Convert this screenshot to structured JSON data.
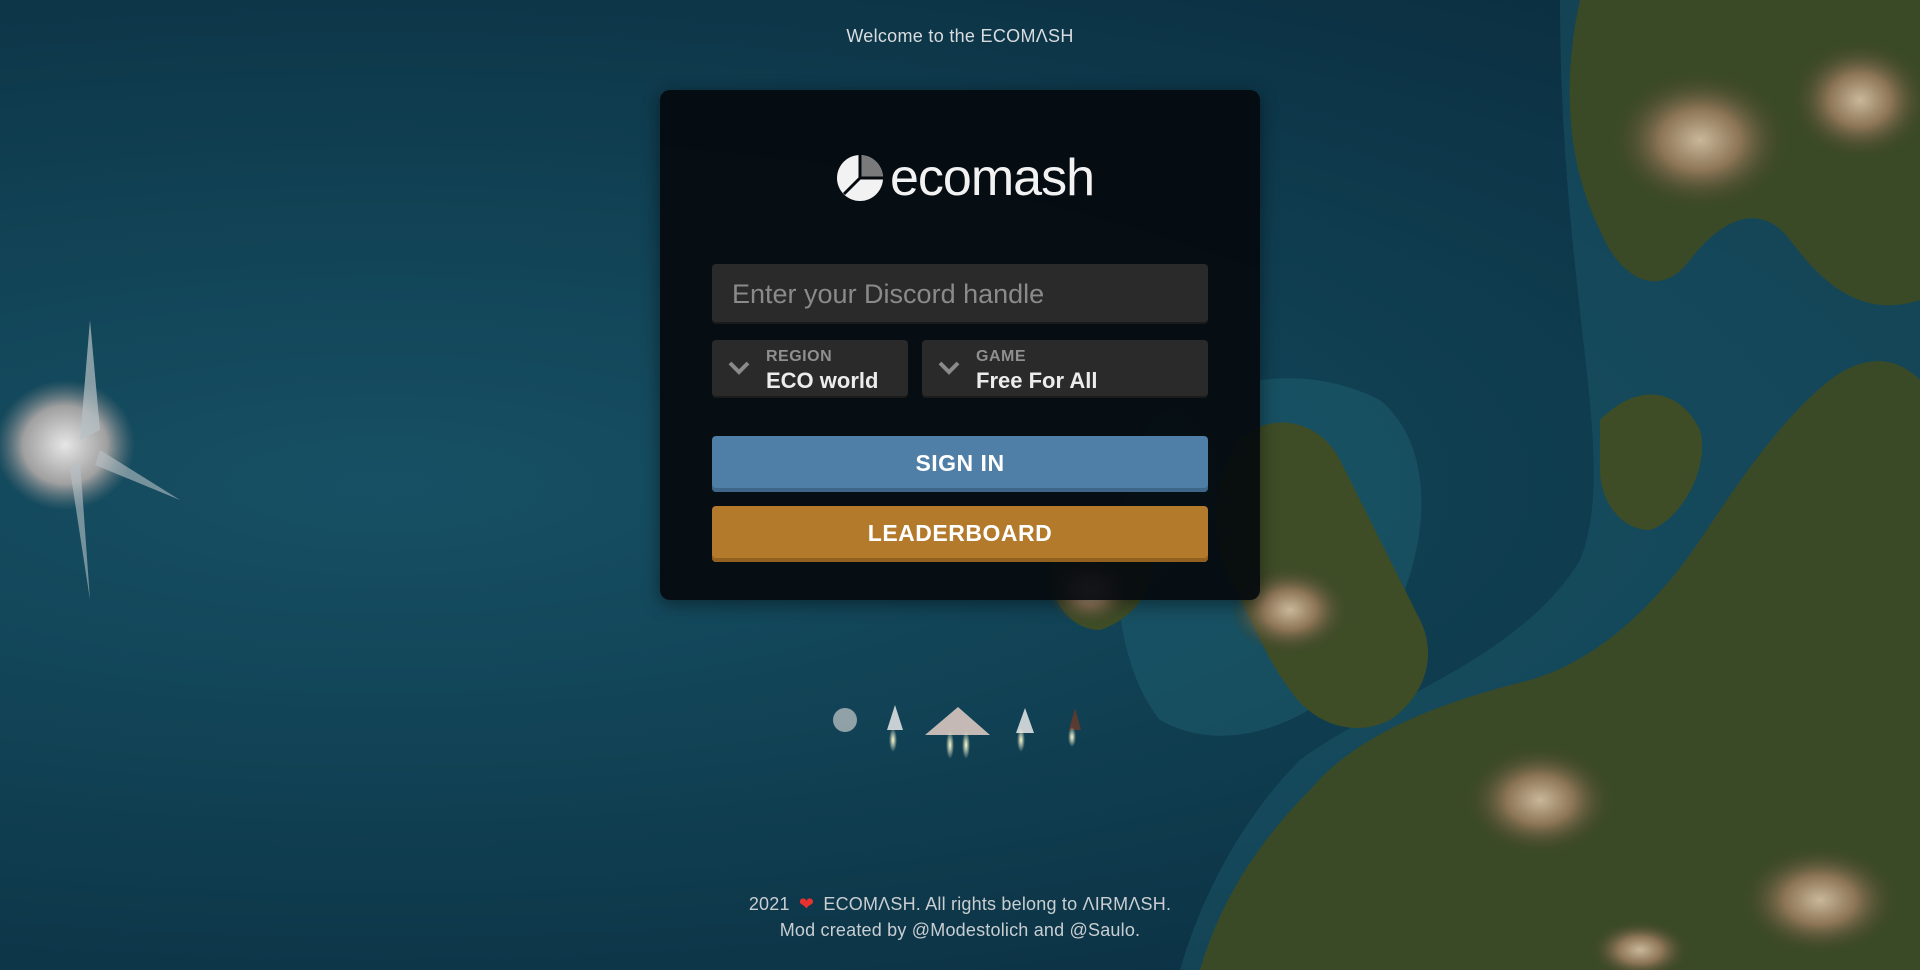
{
  "header": {
    "welcome_text": "Welcome to the ECOMΛSH"
  },
  "logo": {
    "text": "ecomash",
    "icon": "ecomash-logo-icon"
  },
  "form": {
    "handle_placeholder": "Enter your Discord handle",
    "handle_value": "",
    "region": {
      "label": "REGION",
      "value": "ECO world",
      "icon": "chevron-down-icon"
    },
    "game": {
      "label": "GAME",
      "value": "Free For All",
      "icon": "chevron-down-icon"
    },
    "signin_label": "SIGN IN",
    "leaderboard_label": "LEADERBOARD"
  },
  "footer": {
    "year": "2021",
    "heart": "❤",
    "rights": "ECOMΛSH. All rights belong to ΛIRMΛSH.",
    "credits": "Mod created by @Modestolich and @Saulo."
  },
  "colors": {
    "signin": "#4f7ea6",
    "leaderboard": "#b47a2c",
    "panel": "#05090d",
    "ocean": "#114255",
    "land": "#3b4a26"
  }
}
